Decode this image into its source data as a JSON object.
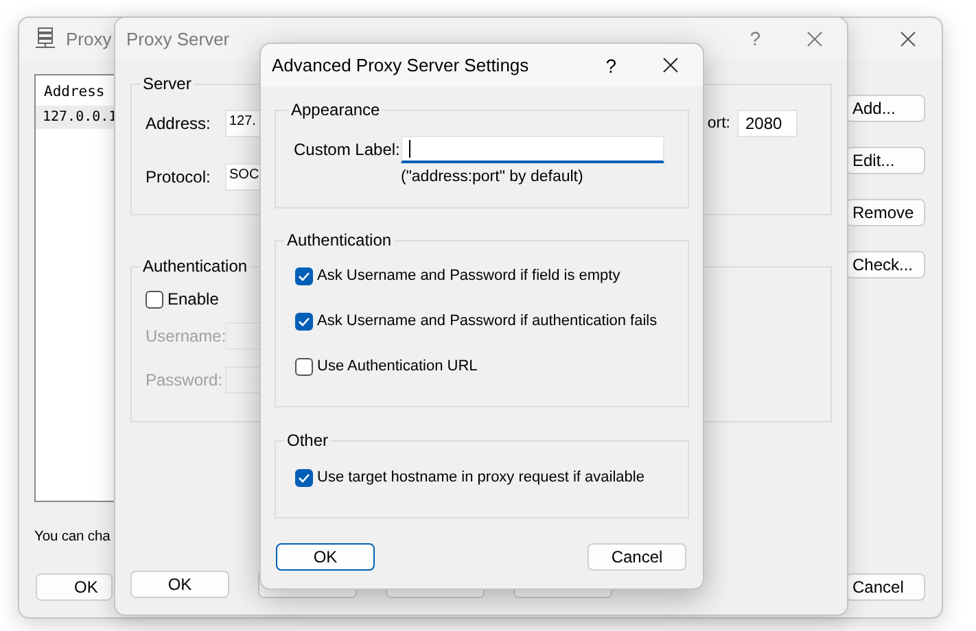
{
  "back_window": {
    "title": "Proxy",
    "list_header": "Address",
    "list_rows": [
      {
        "text": "127.0.0.1",
        "selected": true
      }
    ],
    "side_buttons": [
      "Add...",
      "Edit...",
      "Remove",
      "Check..."
    ],
    "note": "You can cha",
    "buttons": [
      "OK",
      "Cancel"
    ]
  },
  "proxy_window": {
    "title": "Proxy Server",
    "help": "?",
    "server": {
      "title": "Server",
      "address_label": "Address:",
      "address_value": "127.",
      "port_label": "ort:",
      "port_value": "2080",
      "protocol_label": "Protocol:",
      "protocol_value": "SOC"
    },
    "authentication": {
      "title": "Authentication",
      "enable": {
        "label": "Enable",
        "checked": false
      },
      "fields": [
        {
          "label": "Username:",
          "disabled": true
        },
        {
          "label": "Password:",
          "disabled": true
        }
      ]
    },
    "buttons": [
      "OK"
    ]
  },
  "dialog": {
    "title": "Advanced Proxy Server Settings",
    "help": "?",
    "groups": [
      {
        "title": "Appearance",
        "kind": "field",
        "field_label": "Custom Label:",
        "focused": true,
        "hint": "(\"address:port\" by default)"
      },
      {
        "title": "Authentication",
        "kind": "checks",
        "options": [
          {
            "label": "Ask Username and Password if field is empty",
            "checked": true
          },
          {
            "label": "Ask Username and Password if authentication fails",
            "checked": true
          },
          {
            "label": "Use Authentication URL",
            "checked": false
          }
        ]
      },
      {
        "title": "Other",
        "kind": "checks",
        "options": [
          {
            "label": "Use target hostname in proxy request if available",
            "checked": true
          }
        ]
      }
    ],
    "buttons": [
      {
        "label": "OK",
        "default": true
      },
      {
        "label": "Cancel",
        "default": false
      }
    ]
  }
}
